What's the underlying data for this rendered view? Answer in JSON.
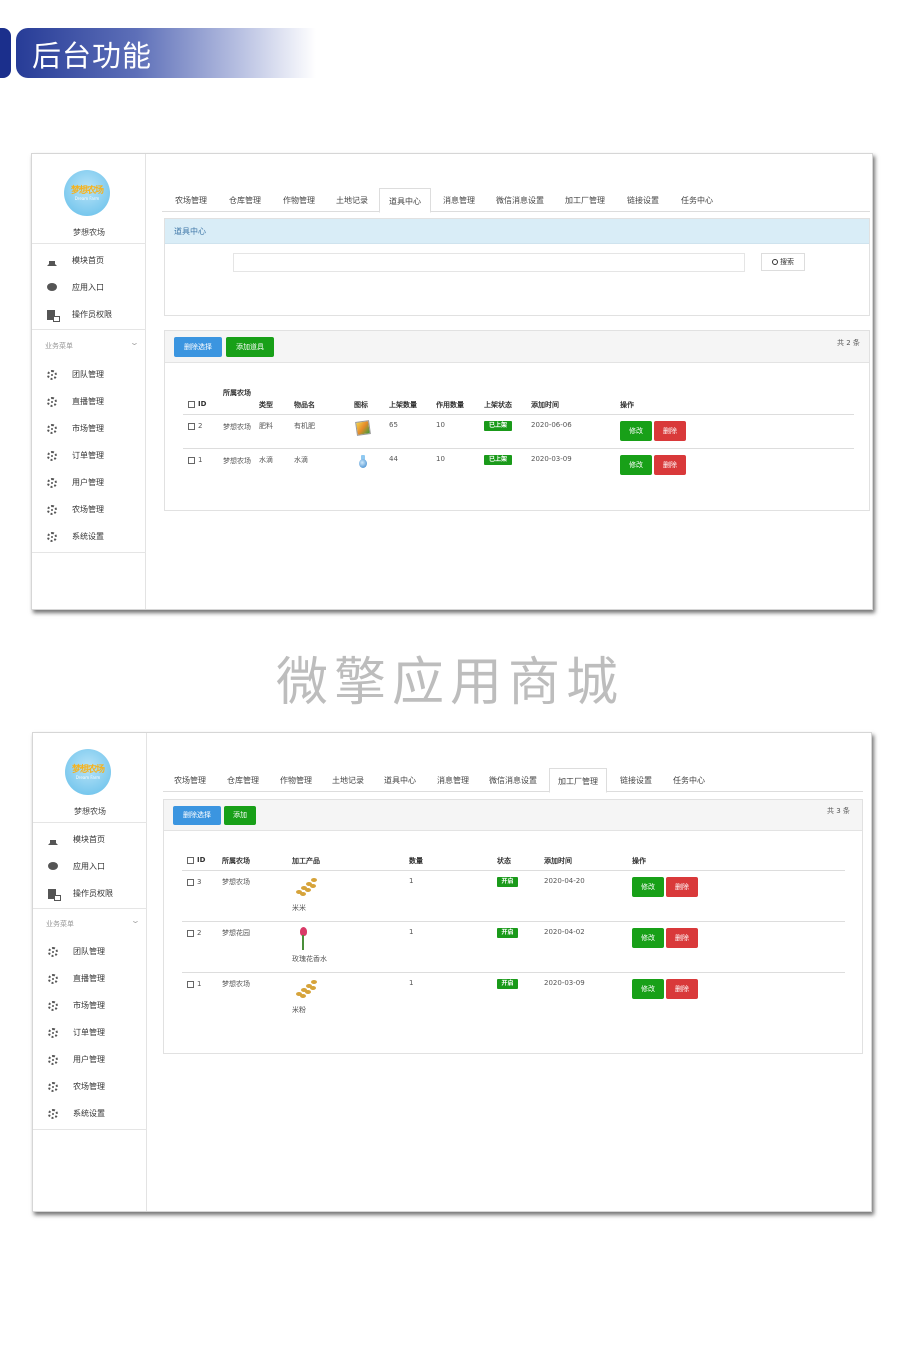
{
  "banner": {
    "title": "后台功能"
  },
  "watermark": "微擎应用商城",
  "sidebar": {
    "logo_text": "梦想农场",
    "logo_sub": "Dream Farm",
    "brand": "梦想农场",
    "top_items": [
      {
        "label": "模块首页",
        "icon": "home-icon"
      },
      {
        "label": "应用入口",
        "icon": "chat-icon"
      },
      {
        "label": "操作员权限",
        "icon": "edit-doc-icon"
      }
    ],
    "section": "业务菜单",
    "menu": [
      {
        "label": "团队管理",
        "icon": "gear-icon"
      },
      {
        "label": "直播管理",
        "icon": "gear-icon"
      },
      {
        "label": "市场管理",
        "icon": "gear-icon"
      },
      {
        "label": "订单管理",
        "icon": "gear-icon"
      },
      {
        "label": "用户管理",
        "icon": "gear-icon"
      },
      {
        "label": "农场管理",
        "icon": "gear-icon"
      },
      {
        "label": "系统设置",
        "icon": "gear-icon"
      }
    ]
  },
  "tabs": [
    "农场管理",
    "仓库管理",
    "作物管理",
    "土地记录",
    "道具中心",
    "消息管理",
    "微信消息设置",
    "加工厂管理",
    "链接设置",
    "任务中心"
  ],
  "screen1": {
    "active_tab": "道具中心",
    "panel_title": "道具中心",
    "search_value": "",
    "search_button": "搜索",
    "btn_delete": "删除选择",
    "btn_add": "添加道具",
    "count": "共 2 条",
    "columns": [
      "ID",
      "所属农场",
      "类型",
      "物品名",
      "图标",
      "上架数量",
      "作用数量",
      "上架状态",
      "添加时间",
      "操作"
    ],
    "rows": [
      {
        "id": "2",
        "farm": "梦想农场",
        "type": "肥料",
        "name": "有机肥",
        "icon": "fertilizer-icon",
        "stock": "65",
        "effect": "10",
        "status": "已上架",
        "date": "2020-06-06",
        "edit": "修改",
        "del": "删除"
      },
      {
        "id": "1",
        "farm": "梦想农场",
        "type": "水滴",
        "name": "水滴",
        "icon": "water-drop-icon",
        "stock": "44",
        "effect": "10",
        "status": "已上架",
        "date": "2020-03-09",
        "edit": "修改",
        "del": "删除"
      }
    ]
  },
  "screen2": {
    "active_tab": "加工厂管理",
    "btn_delete": "删除选择",
    "btn_add": "添加",
    "count": "共 3 条",
    "columns": [
      "ID",
      "所属农场",
      "加工产品",
      "数量",
      "状态",
      "添加时间",
      "操作"
    ],
    "rows": [
      {
        "id": "3",
        "farm": "梦想农场",
        "product": "米米",
        "icon": "wheat-icon",
        "qty": "1",
        "status": "开启",
        "date": "2020-04-20",
        "edit": "修改",
        "del": "删除"
      },
      {
        "id": "2",
        "farm": "梦想花园",
        "product": "玫瑰花香水",
        "icon": "rose-icon",
        "qty": "1",
        "status": "开启",
        "date": "2020-04-02",
        "edit": "修改",
        "del": "删除"
      },
      {
        "id": "1",
        "farm": "梦想农场",
        "product": "米粉",
        "icon": "wheat-icon",
        "qty": "1",
        "status": "开启",
        "date": "2020-03-09",
        "edit": "修改",
        "del": "删除"
      }
    ]
  }
}
